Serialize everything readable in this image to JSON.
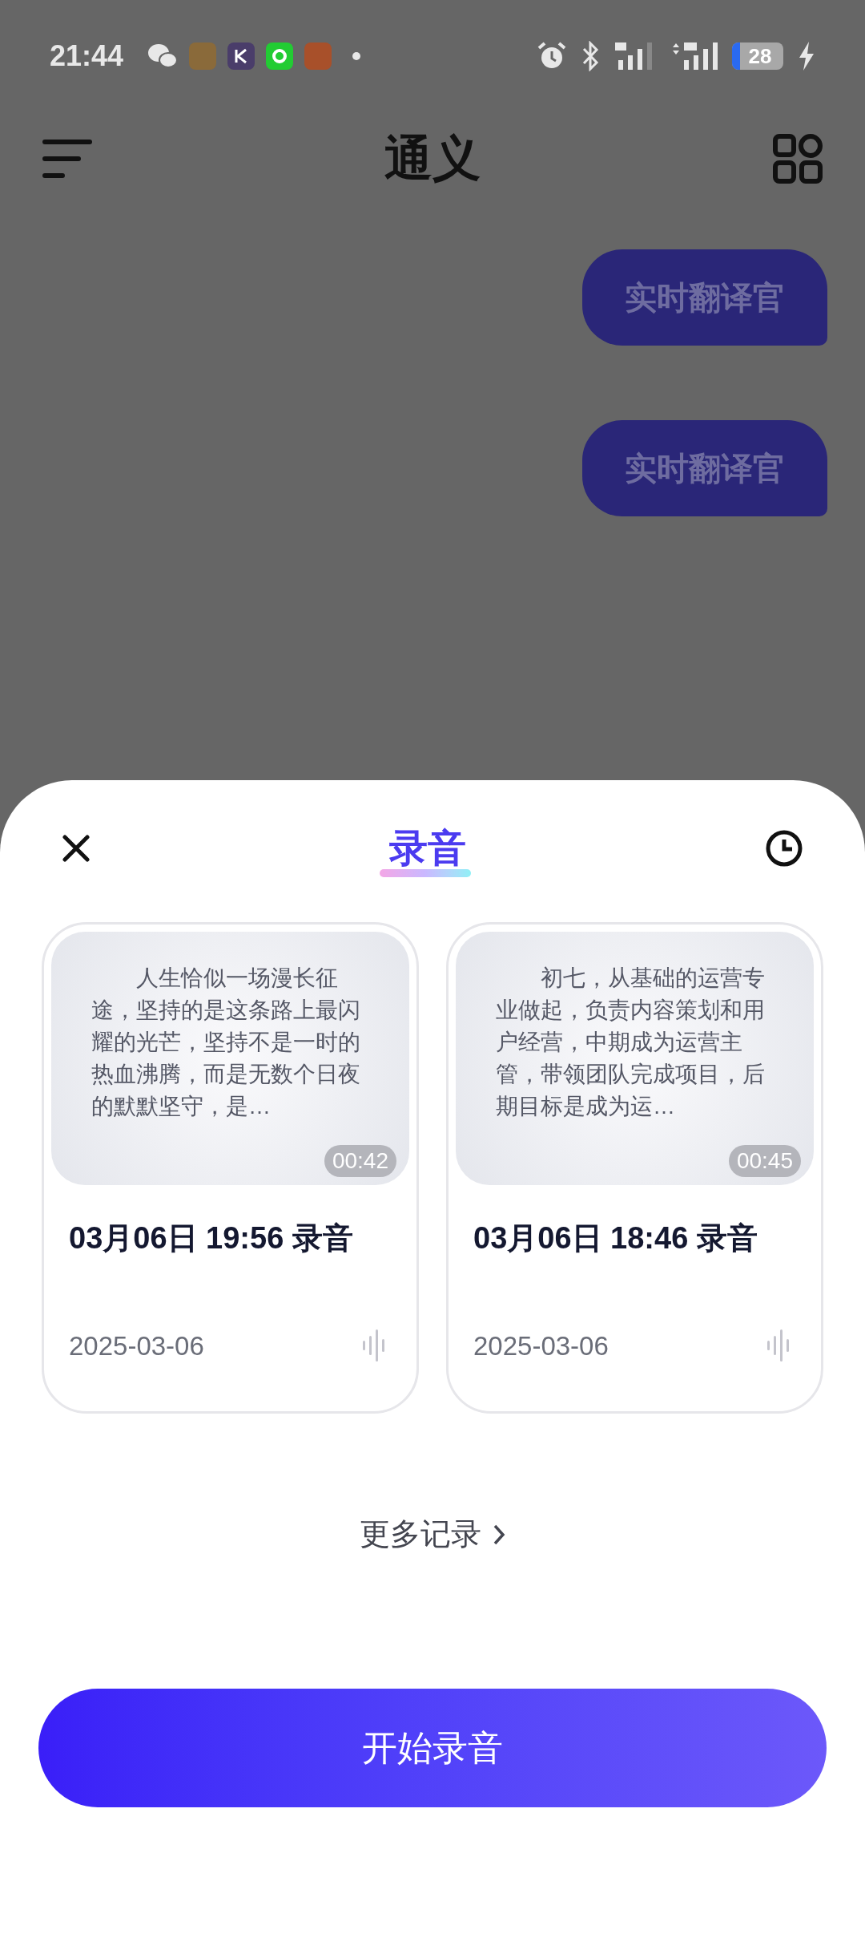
{
  "status_bar": {
    "time": "21:44",
    "battery": "28"
  },
  "header": {
    "title": "通义"
  },
  "messages": [
    {
      "text": "实时翻译官"
    },
    {
      "text": "实时翻译官"
    }
  ],
  "sheet": {
    "title": "录音",
    "recordings": [
      {
        "preview": "人生恰似一场漫长征途，坚持的是这条路上最闪耀的光芒，坚持不是一时的热血沸腾，而是无数个日夜的默默坚守，是…",
        "duration": "00:42",
        "title": "03月06日 19:56 录音",
        "date": "2025-03-06"
      },
      {
        "preview": "初七，从基础的运营专业做起，负责内容策划和用户经营，中期成为运营主管，带领团队完成项目，后期目标是成为运…",
        "duration": "00:45",
        "title": "03月06日 18:46 录音",
        "date": "2025-03-06"
      }
    ],
    "more_link": "更多记录",
    "primary_button": "开始录音"
  }
}
